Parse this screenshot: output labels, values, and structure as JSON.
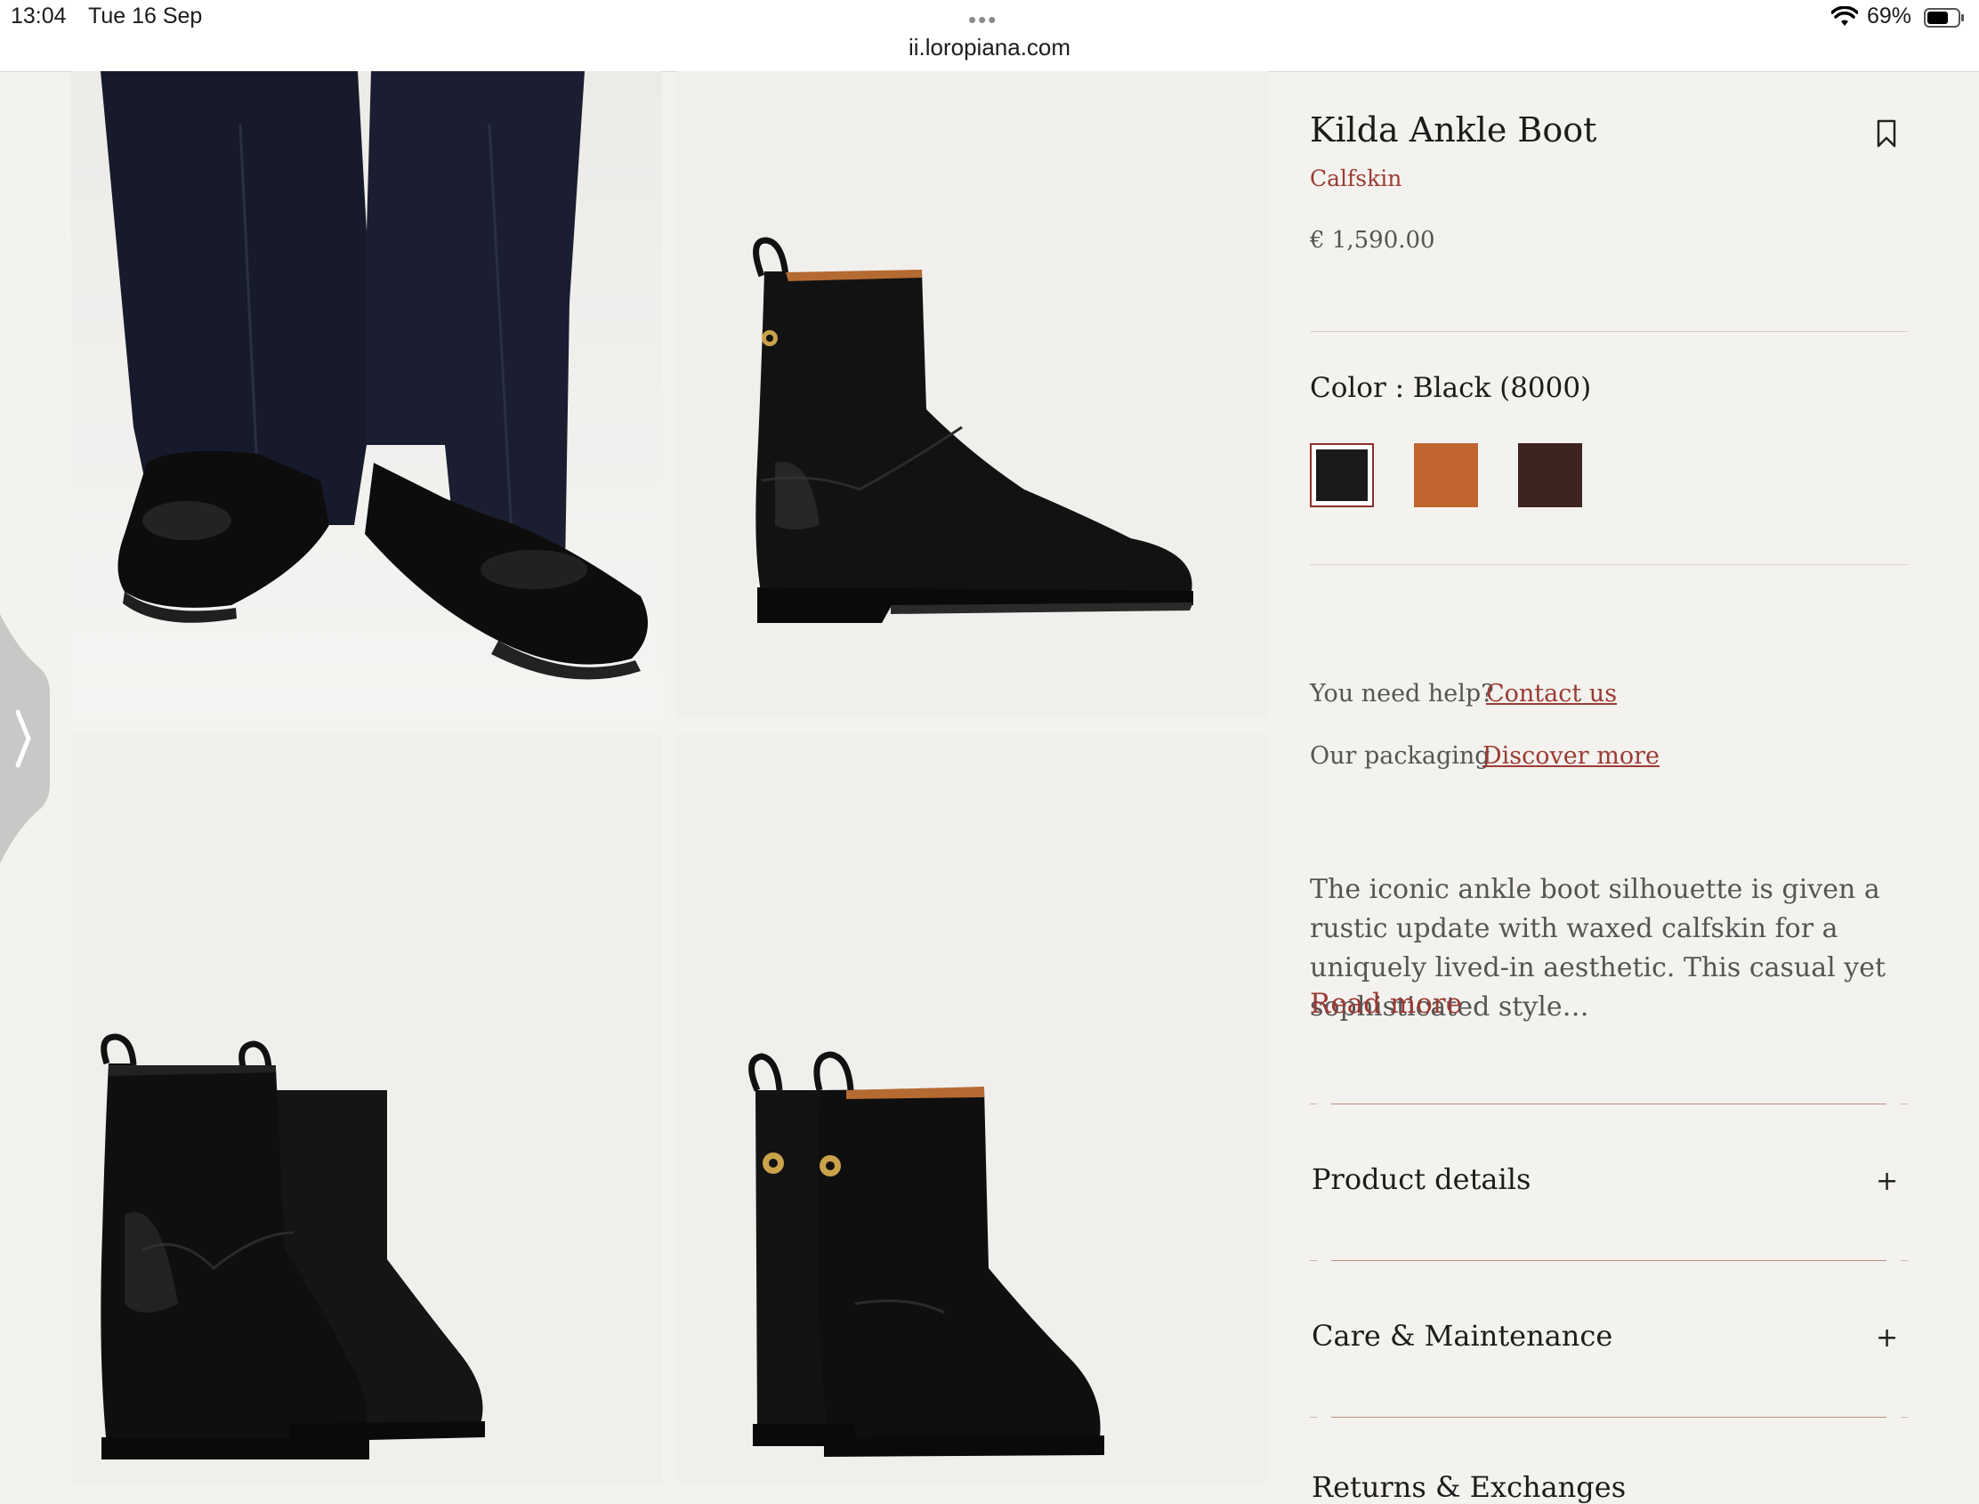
{
  "status_bar": {
    "time": "13:04",
    "date": "Tue 16 Sep",
    "dots": "•••",
    "url": "ii.loropiana.com",
    "battery_percent": "69%",
    "battery_level": 0.69,
    "wifi_icon": "wifi-icon",
    "battery_icon": "battery-icon"
  },
  "gallery": {
    "zoom_button": "+",
    "zoom_icon": "plus-icon",
    "side_handle_icon": "chevron-right-icon"
  },
  "product": {
    "title": "Kilda Ankle Boot",
    "material": "Calfskin",
    "price": "€ 1,590.00",
    "bookmark_icon": "bookmark-icon",
    "color_label": "Color : Black (8000)",
    "swatches": [
      {
        "name": "Black",
        "color": "#1a1a1a",
        "selected": true
      },
      {
        "name": "Tan",
        "color": "#c06530",
        "selected": false
      },
      {
        "name": "Dark Brown",
        "color": "#3d2420",
        "selected": false
      }
    ],
    "help": {
      "text": "You need help?",
      "link": "Contact us"
    },
    "packaging": {
      "text": "Our packaging",
      "link": "Discover more"
    },
    "description": "The iconic ankle boot silhouette is given a rustic update with waxed calfskin for a uniquely lived-in aesthetic. This casual yet sophisticated style…",
    "read_more": "Read more",
    "accordions": [
      {
        "label": "Product details",
        "icon": "+"
      },
      {
        "label": "Care & Maintenance",
        "icon": "+"
      }
    ],
    "next_accordion_partial": "Returns & Exchanges"
  },
  "colors": {
    "accent": "#9b3b33",
    "background": "#f4f2ee"
  }
}
